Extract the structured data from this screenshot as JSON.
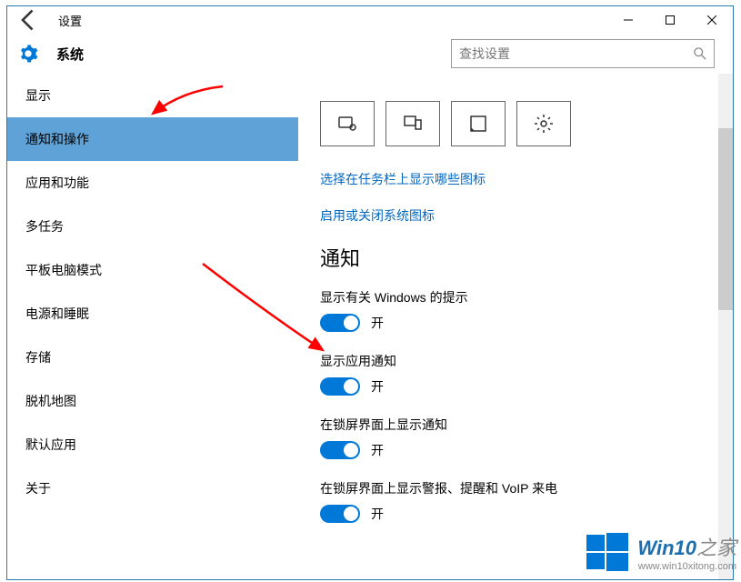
{
  "window": {
    "title": "设置",
    "header": "系统",
    "search_placeholder": "查找设置"
  },
  "sidebar": {
    "items": [
      {
        "label": "显示"
      },
      {
        "label": "通知和操作"
      },
      {
        "label": "应用和功能"
      },
      {
        "label": "多任务"
      },
      {
        "label": "平板电脑模式"
      },
      {
        "label": "电源和睡眠"
      },
      {
        "label": "存储"
      },
      {
        "label": "脱机地图"
      },
      {
        "label": "默认应用"
      },
      {
        "label": "关于"
      }
    ],
    "selected_index": 1
  },
  "content": {
    "links": [
      "选择在任务栏上显示哪些图标",
      "启用或关闭系统图标"
    ],
    "section_heading": "通知",
    "options": [
      {
        "label": "显示有关 Windows 的提示",
        "state": "开"
      },
      {
        "label": "显示应用通知",
        "state": "开"
      },
      {
        "label": "在锁屏界面上显示通知",
        "state": "开"
      },
      {
        "label": "在锁屏界面上显示警报、提醒和 VoIP 来电",
        "state": "开"
      }
    ]
  },
  "watermark": {
    "brand_main": "Win10",
    "brand_suffix": "之家",
    "url": "www.win10xitong.com"
  }
}
